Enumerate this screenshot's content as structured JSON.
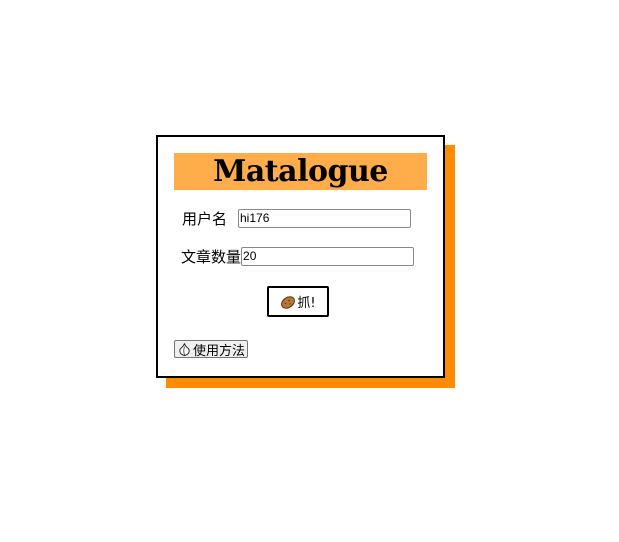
{
  "app": {
    "title": "Matalogue"
  },
  "form": {
    "username_label": "用户名",
    "username_value": "hi176",
    "count_label": "文章数量",
    "count_value": "20",
    "grab_label": "抓!",
    "grab_icon": "potato-icon",
    "help_label": "使用方法",
    "help_icon": "garlic-icon"
  },
  "colors": {
    "accent_shadow": "#ff8c00",
    "title_bar": "#ffad4a",
    "border": "#000000"
  }
}
